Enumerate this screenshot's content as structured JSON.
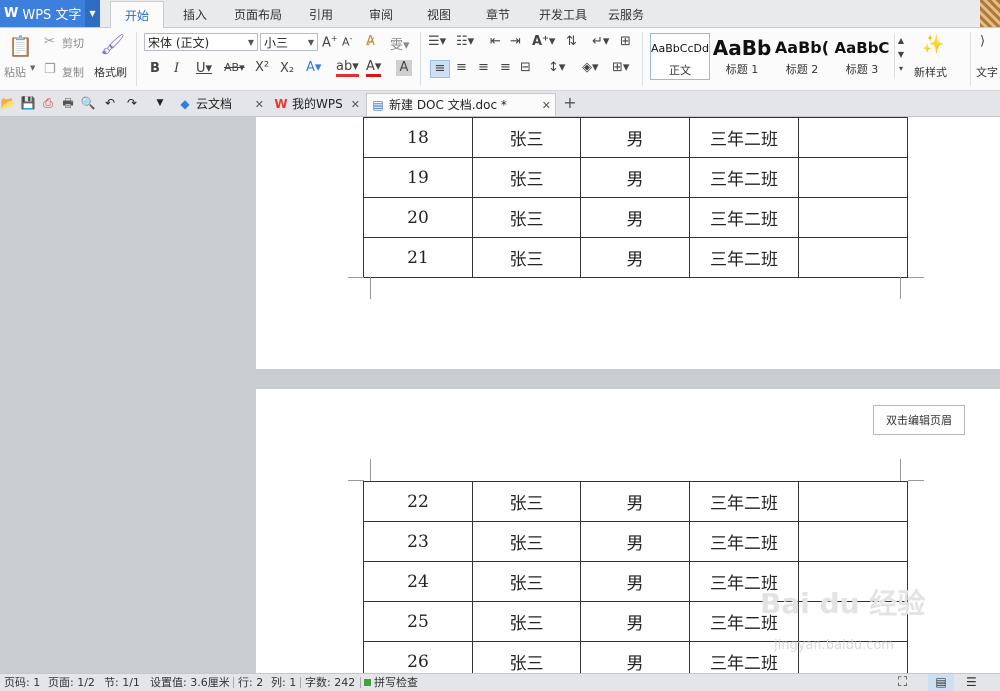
{
  "app": {
    "logo": "W",
    "name": "WPS 文字"
  },
  "menu": {
    "tabs": [
      "开始",
      "插入",
      "页面布局",
      "引用",
      "审阅",
      "视图",
      "章节",
      "开发工具",
      "云服务"
    ]
  },
  "ribbon": {
    "clipboard": {
      "paste": "粘贴",
      "cut": "剪切",
      "copy": "复制",
      "format_painter": "格式刷"
    },
    "font": {
      "name": "宋体 (正文)",
      "size": "小三"
    },
    "styles": [
      {
        "sample": "AaBbCcDd",
        "label": "正文"
      },
      {
        "sample": "AaBb",
        "label": "标题 1"
      },
      {
        "sample": "AaBb(",
        "label": "标题 2"
      },
      {
        "sample": "AaBbC",
        "label": "标题 3"
      }
    ],
    "new_style": "新样式",
    "text_tool": "文字"
  },
  "tabs": {
    "items": [
      {
        "label": "云文档",
        "icon": "cube-icon"
      },
      {
        "label": "我的WPS",
        "icon": "wps-logo-icon"
      },
      {
        "label": "新建 DOC 文档.doc *",
        "icon": "document-icon"
      }
    ]
  },
  "document": {
    "page1_rows": [
      [
        "18",
        "张三",
        "男",
        "三年二班",
        ""
      ],
      [
        "19",
        "张三",
        "男",
        "三年二班",
        ""
      ],
      [
        "20",
        "张三",
        "男",
        "三年二班",
        ""
      ],
      [
        "21",
        "张三",
        "男",
        "三年二班",
        ""
      ]
    ],
    "page2_rows": [
      [
        "22",
        "张三",
        "男",
        "三年二班",
        ""
      ],
      [
        "23",
        "张三",
        "男",
        "三年二班",
        ""
      ],
      [
        "24",
        "张三",
        "男",
        "三年二班",
        ""
      ],
      [
        "25",
        "张三",
        "男",
        "三年二班",
        ""
      ],
      [
        "26",
        "张三",
        "男",
        "三年二班",
        ""
      ]
    ],
    "header_hint": "双击编辑页眉"
  },
  "watermark": {
    "brand": "Bai du 经验",
    "url": "jingyan.baidu.com"
  },
  "status": {
    "page_no": "页码: 1",
    "pages": "页面: 1/2",
    "section": "节: 1/1",
    "setting": "设置值: 3.6厘米",
    "row": "行: 2",
    "col": "列: 1",
    "words": "字数: 242",
    "spell": "拼写检查"
  },
  "colors": {
    "accent": "#3d7fdc",
    "tab_active_text": "#2b6cc6",
    "page_bg": "#ffffff",
    "workspace": "#c9ccd1"
  }
}
